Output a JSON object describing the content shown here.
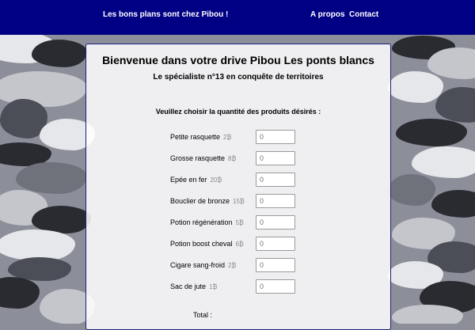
{
  "navbar": {
    "brand": "Les bons plans sont chez Pibou !",
    "links": [
      "A propos",
      "Contact"
    ]
  },
  "panel": {
    "title": "Bienvenue dans votre drive Pibou Les ponts blancs",
    "subtitle": "Le spécialiste n°13 en conquête de territoires",
    "instruction": "Veuillez choisir la quantité des produits désirés :",
    "products": [
      {
        "name": "Petite rasquette",
        "price": "2₿",
        "quantity": "",
        "placeholder": "0"
      },
      {
        "name": "Grosse rasquette",
        "price": "8₿",
        "quantity": "",
        "placeholder": "0"
      },
      {
        "name": "Epée en fer",
        "price": "20₿",
        "quantity": "",
        "placeholder": "0"
      },
      {
        "name": "Bouclier de bronze",
        "price": "15₿",
        "quantity": "",
        "placeholder": "0"
      },
      {
        "name": "Potion régénération",
        "price": "5₿",
        "quantity": "",
        "placeholder": "0"
      },
      {
        "name": "Potion boost cheval",
        "price": "6₿",
        "quantity": "",
        "placeholder": "0"
      },
      {
        "name": "Cigare sang-froid",
        "price": "2₿",
        "quantity": "",
        "placeholder": "0"
      },
      {
        "name": "Sac de jute",
        "price": "1₿",
        "quantity": "",
        "placeholder": "0"
      }
    ],
    "total_label": "Total :"
  },
  "colors": {
    "navbar_bg": "#000085",
    "panel_border": "#1c1f7a"
  }
}
